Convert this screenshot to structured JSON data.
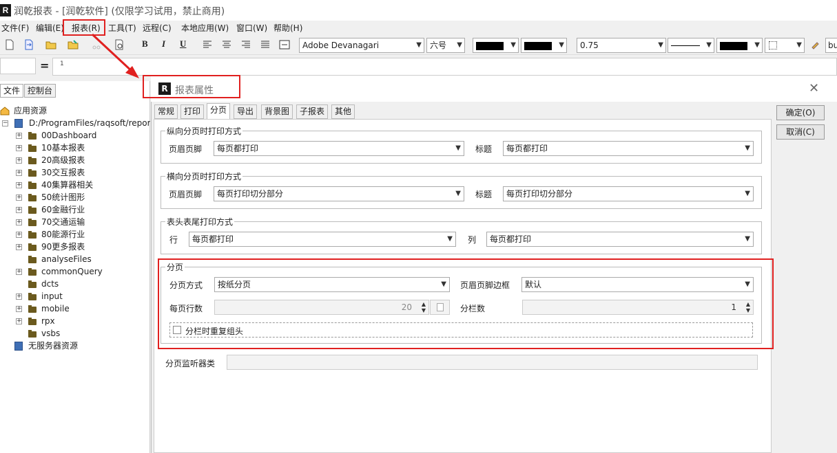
{
  "window": {
    "title": "润乾报表 - [润乾软件] (仅限学习试用，禁止商用)",
    "logo_letter": "R"
  },
  "menu": [
    {
      "label": "文件(F)"
    },
    {
      "label": "编辑(E)"
    },
    {
      "label": "报表(R)"
    },
    {
      "label": "工具(T)"
    },
    {
      "label": "远程(C)"
    },
    {
      "label": "本地应用(W)"
    },
    {
      "label": "窗口(W)"
    },
    {
      "label": "帮助(H)"
    }
  ],
  "toolbar": {
    "bold": "B",
    "italic": "I",
    "underline": "U",
    "font_family": "Adobe Devanagari",
    "font_size": "六号",
    "line_width": "0.75",
    "truncated": "bu",
    "fore_color": "#000000",
    "back_color": "#000000",
    "border_color": "#000000"
  },
  "formula": {
    "eq": "=",
    "value": "1"
  },
  "left_panel": {
    "tabs": [
      "文件",
      "控制台"
    ],
    "root": "应用资源",
    "path": "D:/ProgramFiles/raqsoft/report/v",
    "items": [
      {
        "label": "00Dashboard",
        "expandable": true
      },
      {
        "label": "10基本报表",
        "expandable": true
      },
      {
        "label": "20高级报表",
        "expandable": true
      },
      {
        "label": "30交互报表",
        "expandable": true
      },
      {
        "label": "40集算器相关",
        "expandable": true
      },
      {
        "label": "50统计图形",
        "expandable": true
      },
      {
        "label": "60金融行业",
        "expandable": true
      },
      {
        "label": "70交通运输",
        "expandable": true
      },
      {
        "label": "80能源行业",
        "expandable": true
      },
      {
        "label": "90更多报表",
        "expandable": true
      },
      {
        "label": "analyseFiles",
        "expandable": false
      },
      {
        "label": "commonQuery",
        "expandable": true
      },
      {
        "label": "dcts",
        "expandable": false
      },
      {
        "label": "input",
        "expandable": true
      },
      {
        "label": "mobile",
        "expandable": true
      },
      {
        "label": "rpx",
        "expandable": true
      },
      {
        "label": "vsbs",
        "expandable": false
      }
    ],
    "no_server": "无服务器资源"
  },
  "dialog": {
    "title": "报表属性",
    "logo_letter": "R",
    "close": "✕",
    "tabs": [
      "常规",
      "打印",
      "分页",
      "导出",
      "背景图",
      "子报表",
      "其他"
    ],
    "active_tab": "分页",
    "ok": "确定(O)",
    "cancel": "取消(C)",
    "vertical": {
      "title": "纵向分页时打印方式",
      "header_footer_label": "页眉页脚",
      "header_footer_value": "每页都打印",
      "title_label": "标题",
      "title_value": "每页都打印"
    },
    "horizontal": {
      "title": "横向分页时打印方式",
      "header_footer_label": "页眉页脚",
      "header_footer_value": "每页打印切分部分",
      "title_label": "标题",
      "title_value": "每页打印切分部分"
    },
    "head_tail": {
      "title": "表头表尾打印方式",
      "row_label": "行",
      "row_value": "每页都打印",
      "col_label": "列",
      "col_value": "每页都打印"
    },
    "paging": {
      "title": "分页",
      "mode_label": "分页方式",
      "mode_value": "按纸分页",
      "border_label": "页眉页脚边框",
      "border_value": "默认",
      "rows_label": "每页行数",
      "rows_value": "20",
      "cols_label": "分栏数",
      "cols_value": "1",
      "repeat_label": "分栏时重复组头",
      "repeat_checked": false
    },
    "listener_label": "分页监听器类",
    "listener_value": ""
  },
  "annotation_color": "#e0201f"
}
